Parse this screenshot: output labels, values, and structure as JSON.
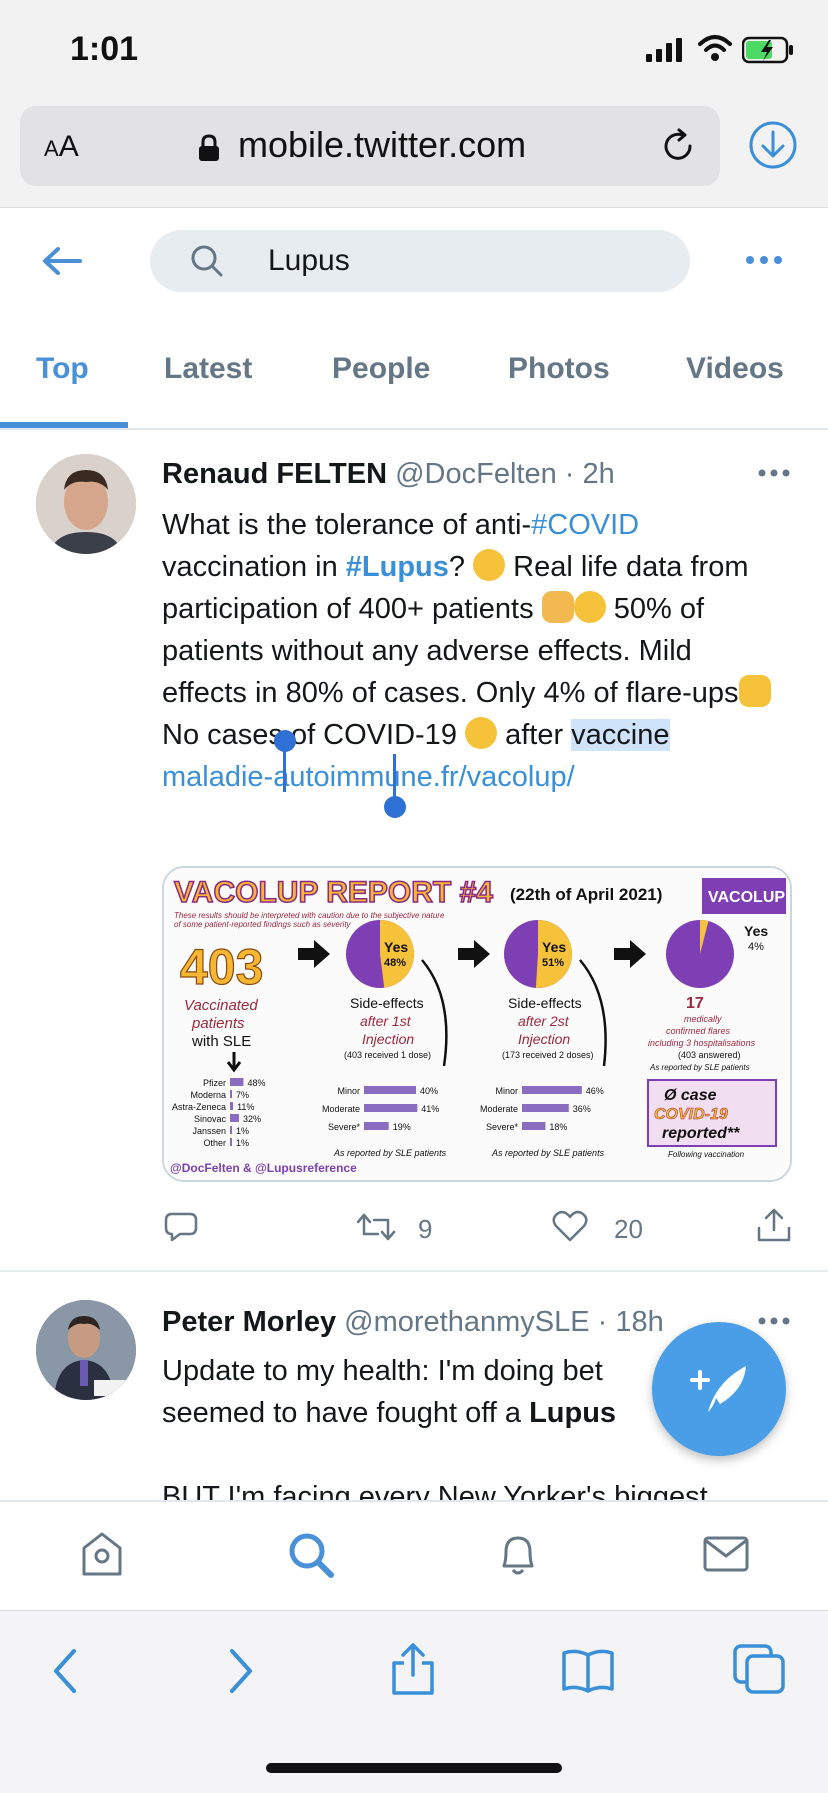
{
  "status_bar": {
    "time": "1:01"
  },
  "browser": {
    "text_size_label_small": "A",
    "text_size_label_large": "A",
    "url": "mobile.twitter.com"
  },
  "search": {
    "query": "Lupus"
  },
  "tabs": [
    {
      "label": "Top",
      "active": true
    },
    {
      "label": "Latest",
      "active": false
    },
    {
      "label": "People",
      "active": false
    },
    {
      "label": "Photos",
      "active": false
    },
    {
      "label": "Videos",
      "active": false
    }
  ],
  "tweets": [
    {
      "name": "Renaud FELTEN",
      "handle": "@DocFelten",
      "time": "2h",
      "text": {
        "p1": "What is the tolerance of anti-",
        "hashtag1": "#COVID",
        "p2": "vaccination in ",
        "hashtag2": "#Lupus",
        "p3": "?",
        "p4": " Real life data from participation of 400+ patients ",
        "p5": "50% of patients without any adverse effects. Mild effects in 80% of cases. Only 4% of flare-ups",
        "p6": " No cases of COVID-19",
        "p7": " after ",
        "selected": "vaccine",
        "link": "maladie-autoimmune.fr/vacolup/"
      },
      "card": {
        "title": "VACOLUP REPORT #4",
        "date": "(22th of April 2021)",
        "badge": "VACOLUP",
        "note1": "These results should be interpreted with caution due to the subjective nature",
        "note2": "of some patient-reported findings such as severity",
        "count": "403",
        "count_label1": "Vaccinated",
        "count_label2": "patients",
        "count_label3": "with SLE",
        "pie1_label": "Yes",
        "pie1_value": "48%",
        "pie2_label": "Yes",
        "pie2_value": "51%",
        "pie3_label": "Yes",
        "pie3_value": "4%",
        "se1_a": "Side-effects",
        "se1_b": "after 1st",
        "se1_c": "Injection",
        "se1_d": "(403 received 1 dose)",
        "se2_a": "Side-effects",
        "se2_b": "after 2st",
        "se2_c": "Injection",
        "se2_d": "(173 received 2 doses)",
        "flares_count": "17",
        "flares_a": "medically",
        "flares_b": "confirmed flares",
        "flares_c": "including 3 hospitalisations",
        "flares_d": "(403 answered)",
        "flares_e": "As reported by SLE patients",
        "case_a": "Ø case",
        "case_b": "COVID-19",
        "case_c": "reported**",
        "case_d": "Following vaccination",
        "vaccines": [
          {
            "name": "Pfizer",
            "value": "48%",
            "frac": 0.48
          },
          {
            "name": "Moderna",
            "value": "7%",
            "frac": 0.07
          },
          {
            "name": "Astra-Zeneca",
            "value": "11%",
            "frac": 0.11
          },
          {
            "name": "Sinovac",
            "value": "32%",
            "frac": 0.32
          },
          {
            "name": "Janssen",
            "value": "1%",
            "frac": 0.01
          },
          {
            "name": "Other",
            "value": "1%",
            "frac": 0.01
          }
        ],
        "sev1": [
          {
            "name": "Minor",
            "value": "40%",
            "frac": 0.4
          },
          {
            "name": "Moderate",
            "value": "41%",
            "frac": 0.41
          },
          {
            "name": "Severe*",
            "value": "19%",
            "frac": 0.19
          }
        ],
        "sev2": [
          {
            "name": "Minor",
            "value": "46%",
            "frac": 0.46
          },
          {
            "name": "Moderate",
            "value": "36%",
            "frac": 0.36
          },
          {
            "name": "Severe*",
            "value": "18%",
            "frac": 0.18
          }
        ],
        "reported1": "As reported by SLE patients",
        "reported2": "As reported by SLE patients",
        "footer": "@DocFelten & @Lupusreference"
      },
      "retweets": "9",
      "likes": "20"
    },
    {
      "name": "Peter Morley",
      "handle": "@morethanmySLE",
      "time": "18h",
      "text": {
        "line1": "Update to my health: I'm doing bet",
        "line2a": "seemed to have fought off a ",
        "line2b": "Lupus",
        "line3": "BUT I'm facing every New Yorker's biggest"
      }
    }
  ],
  "colors": {
    "accent": "#4a90d9",
    "link": "#3a8fd9",
    "muted": "#657786",
    "fab": "#4a9ee8"
  },
  "icons": [
    "back-arrow-icon",
    "search-icon",
    "more-icon",
    "reply-icon",
    "retweet-icon",
    "like-icon",
    "share-icon",
    "home-icon",
    "notifications-icon",
    "messages-icon",
    "compose-icon"
  ]
}
